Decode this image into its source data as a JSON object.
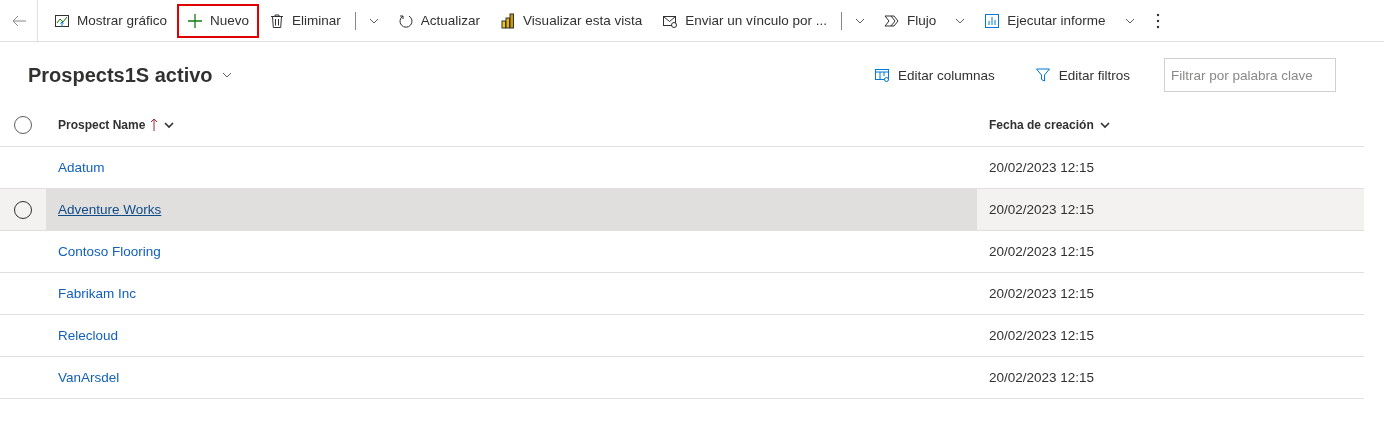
{
  "toolbar": {
    "items": [
      {
        "label": "Mostrar gráfico",
        "kind": "button",
        "highlighted": false
      },
      {
        "label": "Nuevo",
        "kind": "button",
        "highlighted": true
      },
      {
        "label": "Eliminar",
        "kind": "split",
        "highlighted": false
      },
      {
        "label": "Actualizar",
        "kind": "button",
        "highlighted": false
      },
      {
        "label": "Visualizar esta vista",
        "kind": "button",
        "highlighted": false
      },
      {
        "label": "Enviar un vínculo por ...",
        "kind": "split",
        "highlighted": false
      },
      {
        "label": "Flujo",
        "kind": "menu",
        "highlighted": false
      },
      {
        "label": "Ejecutar informe",
        "kind": "menu",
        "highlighted": false
      }
    ]
  },
  "view": {
    "title": "Prospects1S activo",
    "actions": [
      "Editar columnas",
      "Editar filtros"
    ],
    "search": {
      "placeholder": "Filtrar por palabra clave"
    }
  },
  "table": {
    "all_selected": false,
    "columns": [
      {
        "label": "Prospect Name",
        "sorted": true
      },
      {
        "label": "Fecha de creación",
        "sorted": false
      }
    ],
    "rows": [
      {
        "name": "Adatum",
        "created": "20/02/2023 12:15",
        "hovered": false
      },
      {
        "name": "Adventure Works",
        "created": "20/02/2023 12:15",
        "hovered": true,
        "selected": false
      },
      {
        "name": "Contoso Flooring",
        "created": "20/02/2023 12:15",
        "hovered": false
      },
      {
        "name": "Fabrikam Inc",
        "created": "20/02/2023 12:15",
        "hovered": false
      },
      {
        "name": "Relecloud",
        "created": "20/02/2023 12:15",
        "hovered": false
      },
      {
        "name": "VanArsdel",
        "created": "20/02/2023 12:15",
        "hovered": false
      }
    ]
  }
}
